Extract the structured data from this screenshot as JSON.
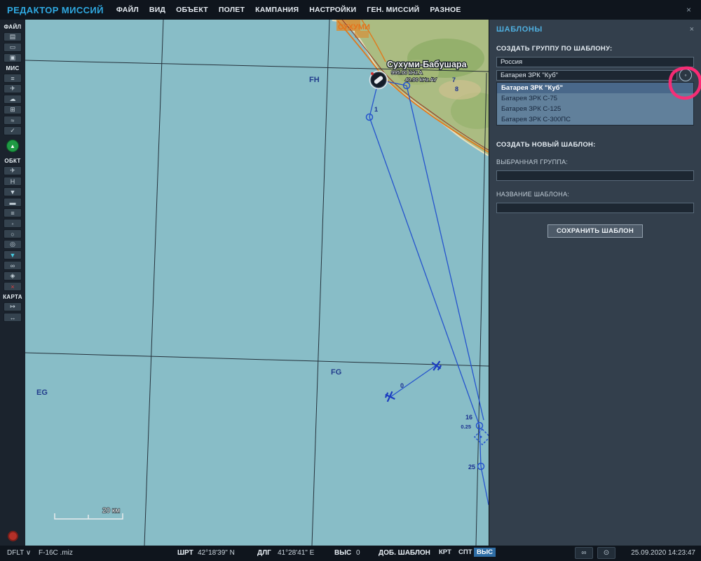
{
  "window": {
    "title": "РЕДАКТОР МИССИЙ",
    "close_icon": "×"
  },
  "menu": {
    "items": [
      "ФАЙЛ",
      "ВИД",
      "ОБЪЕКТ",
      "ПОЛЕТ",
      "КАМПАНИЯ",
      "НАСТРОЙКИ",
      "ГЕН. МИССИЙ",
      "РАЗНОЕ"
    ]
  },
  "sidebar": {
    "sections": {
      "file": "ФАЙЛ",
      "mission": "МИС",
      "objects": "ОБКТ",
      "map": "КАРТА"
    },
    "icons": {
      "new_mission": "▤",
      "open_mission": "▭",
      "save_mission": "▣",
      "briefing": "≡",
      "payload": "✈",
      "weather": "☁",
      "goals": "⊞",
      "routes": "≈",
      "validate": "✓",
      "fly_mission": "▲",
      "airplane": "✈",
      "helicopter": "H",
      "ship": "▼",
      "vehicle": "▬",
      "column": "≡",
      "static_object": "◦",
      "trigger_zone": "○",
      "target": "◎",
      "naval_group": "▼",
      "ammo": "∞",
      "shapes": "◈",
      "delete": "×",
      "measure": "↦",
      "ruler": "↔",
      "record": "●"
    }
  },
  "map": {
    "city_label": "СУХУМИ",
    "airport_label": "Сухуми-Бабушара",
    "airport_freq1": "995.00 kHz A",
    "airport_freq2": "40.00 kHz AV",
    "grid_fh": "FH",
    "grid_fg": "FG",
    "grid_eg": "EG",
    "scale_label": "20 км",
    "route_labels": {
      "n1": "1",
      "n7": "7",
      "n8": "8",
      "n0": "0",
      "n16": "16",
      "n025": "0.25",
      "n25": "25"
    }
  },
  "templates_panel": {
    "title": "ШАБЛОНЫ",
    "close_icon": "×",
    "create_group_label": "СОЗДАТЬ ГРУППУ ПО ШАБЛОНУ:",
    "country_value": "Россия",
    "template_value": "Батарея ЗРК \"Куб\"",
    "manage_icon": "◦",
    "options": [
      "Батарея ЗРК \"Куб\"",
      "Батарея ЗРК С-75",
      "Батарея ЗРК С-125",
      "Батарея ЗРК С-300ПС"
    ],
    "create_new_label": "СОЗДАТЬ НОВЫЙ ШАБЛОН:",
    "selected_group_label": "ВЫБРАННАЯ ГРУППА:",
    "selected_group_value": "",
    "template_name_label": "НАЗВАНИЕ ШАБЛОНА:",
    "template_name_value": "",
    "save_button": "СОХРАНИТЬ ШАБЛОН"
  },
  "statusbar": {
    "profile": "DFLT",
    "profile_chevron": "∨",
    "filename": "F-16C .miz",
    "lat_label": "ШРТ",
    "lat_value": "42°18'39\" N",
    "lon_label": "ДЛГ",
    "lon_value": "41°28'41\" E",
    "alt_label": "ВЫС",
    "alt_value": "0",
    "add_template_label": "ДОБ. ШАБЛОН",
    "toggle_map": "КРТ",
    "toggle_sat": "СПТ",
    "toggle_alt": "ВЫС",
    "goggles_icon": "∞",
    "gauge_icon": "⊙",
    "datetime": "25.09.2020 14:23:47"
  },
  "colors": {
    "accent": "#2fa9e1",
    "sea": "#88bdc7",
    "route": "#2553cd",
    "annotation": "#ff2b76"
  }
}
